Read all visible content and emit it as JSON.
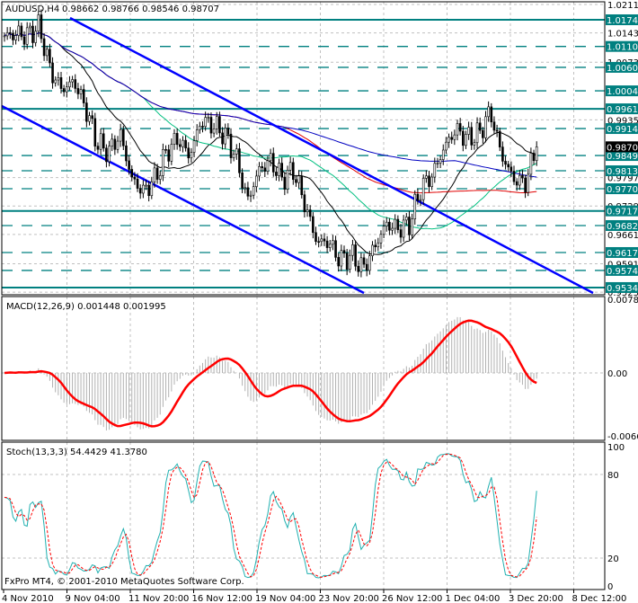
{
  "header": {
    "symbol_tf": "AUDUSD,H4",
    "ohlc": "0.98662 0.98766 0.98546 0.98707"
  },
  "macd": {
    "label": "MACD(12,26,9) 0.001448 0.001995",
    "ticks": [
      "0.00782",
      "0.00",
      "-0.00667"
    ],
    "range": [
      -0.00667,
      0.00782
    ]
  },
  "stoch": {
    "label": "Stoch(13,3,3) 54.4429 41.3780",
    "ticks": [
      "100",
      "80",
      "20",
      "0"
    ]
  },
  "copyright": "FxPro MT4, © 2001-2010 MetaQuotes Software Corp.",
  "colors": {
    "level": "#008080",
    "trend": "#0000ff",
    "ma_fast": "#000000",
    "ma_green": "#00c080",
    "ma_red": "#e00000",
    "ma_blue": "#0000c0",
    "signal": "#ff0000",
    "stoch_k": "#20b0b0"
  },
  "chart_data": {
    "type": "candlestick",
    "title": "AUDUSD,H4",
    "ylim": [
      0.9523,
      1.0211
    ],
    "current_price": "0.98707",
    "price_ticks": [
      "1.02110",
      "1.01430",
      "1.00730",
      "0.99350",
      "0.97970",
      "0.97290",
      "0.96610",
      "0.95910",
      "0.95230"
    ],
    "levels_solid": [
      "1.01745",
      "0.99615",
      "0.97173",
      "0.95340"
    ],
    "levels_dashed": [
      "1.01107",
      "1.00607",
      "1.00045",
      "0.99143",
      "0.98498",
      "0.98133",
      "0.97703",
      "0.96823",
      "0.96178",
      "0.95749"
    ],
    "time_labels": [
      "4 Nov 2010",
      "9 Nov 04:00",
      "11 Nov 20:00",
      "16 Nov 12:00",
      "19 Nov 04:00",
      "23 Nov 20:00",
      "26 Nov 12:00",
      "1 Dec 04:00",
      "3 Dec 20:00",
      "8 Dec 12:00"
    ],
    "close_path": [
      1.0136,
      1.014,
      1.0138,
      1.0158,
      1.005,
      1.0007,
      1.0028,
      0.9964,
      0.988,
      0.9858,
      0.9901,
      0.9794,
      0.9763,
      0.9794,
      0.9858,
      0.9891,
      0.9848,
      0.9934,
      0.9923,
      0.9901,
      0.9848,
      0.9741,
      0.9815,
      0.9837,
      0.9794,
      0.9815,
      0.9729,
      0.9643,
      0.9643,
      0.96,
      0.9611,
      0.9578,
      0.9632,
      0.9686,
      0.9675,
      0.9686,
      0.9772,
      0.9804,
      0.9869,
      0.9912,
      0.9891,
      0.9901,
      0.9955,
      0.9848,
      0.9794,
      0.9783,
      0.9871
    ]
  }
}
